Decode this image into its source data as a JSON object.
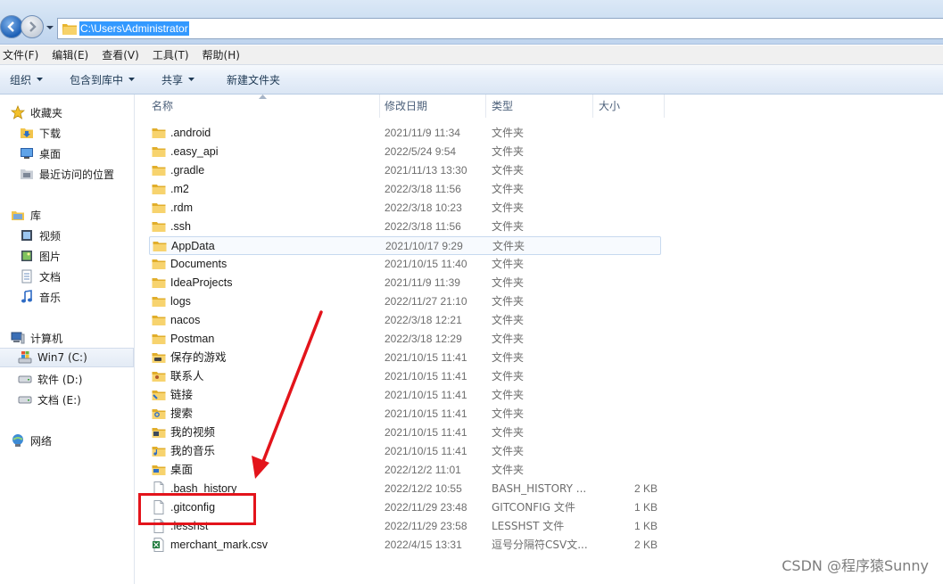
{
  "address": {
    "path": "C:\\Users\\Administrator"
  },
  "menu": [
    "文件(F)",
    "编辑(E)",
    "查看(V)",
    "工具(T)",
    "帮助(H)"
  ],
  "toolbar": {
    "organize": "组织",
    "include_library": "包含到库中",
    "share": "共享",
    "new_folder": "新建文件夹"
  },
  "nav": {
    "favorites": "收藏夹",
    "downloads": "下载",
    "desktop": "桌面",
    "recent": "最近访问的位置",
    "libraries": "库",
    "videos": "视频",
    "pictures": "图片",
    "documents": "文档",
    "music": "音乐",
    "computer": "计算机",
    "drive_c": "Win7 (C:)",
    "drive_d": "软件 (D:)",
    "drive_e": "文档 (E:)",
    "network": "网络"
  },
  "columns": {
    "name": "名称",
    "modified": "修改日期",
    "type": "类型",
    "size": "大小"
  },
  "files": [
    {
      "name": ".android",
      "date": "2021/11/9 11:34",
      "type": "文件夹",
      "size": "",
      "icon": "folder-icon"
    },
    {
      "name": ".easy_api",
      "date": "2022/5/24 9:54",
      "type": "文件夹",
      "size": "",
      "icon": "folder-icon"
    },
    {
      "name": ".gradle",
      "date": "2021/11/13 13:30",
      "type": "文件夹",
      "size": "",
      "icon": "folder-icon"
    },
    {
      "name": ".m2",
      "date": "2022/3/18 11:56",
      "type": "文件夹",
      "size": "",
      "icon": "folder-icon"
    },
    {
      "name": ".rdm",
      "date": "2022/3/18 10:23",
      "type": "文件夹",
      "size": "",
      "icon": "folder-icon"
    },
    {
      "name": ".ssh",
      "date": "2022/3/18 11:56",
      "type": "文件夹",
      "size": "",
      "icon": "folder-icon"
    },
    {
      "name": "AppData",
      "date": "2021/10/17 9:29",
      "type": "文件夹",
      "size": "",
      "icon": "folder-icon"
    },
    {
      "name": "Documents",
      "date": "2021/10/15 11:40",
      "type": "文件夹",
      "size": "",
      "icon": "folder-icon"
    },
    {
      "name": "IdeaProjects",
      "date": "2021/11/9 11:39",
      "type": "文件夹",
      "size": "",
      "icon": "folder-icon"
    },
    {
      "name": "logs",
      "date": "2022/11/27 21:10",
      "type": "文件夹",
      "size": "",
      "icon": "folder-icon"
    },
    {
      "name": "nacos",
      "date": "2022/3/18 12:21",
      "type": "文件夹",
      "size": "",
      "icon": "folder-icon"
    },
    {
      "name": "Postman",
      "date": "2022/3/18 12:29",
      "type": "文件夹",
      "size": "",
      "icon": "folder-icon"
    },
    {
      "name": "保存的游戏",
      "date": "2021/10/15 11:41",
      "type": "文件夹",
      "size": "",
      "icon": "saved-games-folder-icon"
    },
    {
      "name": "联系人",
      "date": "2021/10/15 11:41",
      "type": "文件夹",
      "size": "",
      "icon": "contacts-folder-icon"
    },
    {
      "name": "链接",
      "date": "2021/10/15 11:41",
      "type": "文件夹",
      "size": "",
      "icon": "links-folder-icon"
    },
    {
      "name": "搜索",
      "date": "2021/10/15 11:41",
      "type": "文件夹",
      "size": "",
      "icon": "searches-folder-icon"
    },
    {
      "name": "我的视频",
      "date": "2021/10/15 11:41",
      "type": "文件夹",
      "size": "",
      "icon": "videos-folder-icon"
    },
    {
      "name": "我的音乐",
      "date": "2021/10/15 11:41",
      "type": "文件夹",
      "size": "",
      "icon": "music-folder-icon"
    },
    {
      "name": "桌面",
      "date": "2022/12/2 11:01",
      "type": "文件夹",
      "size": "",
      "icon": "desktop-folder-icon"
    },
    {
      "name": ".bash_history",
      "date": "2022/12/2 10:55",
      "type": "BASH_HISTORY ...",
      "size": "2 KB",
      "icon": "file-icon"
    },
    {
      "name": ".gitconfig",
      "date": "2022/11/29 23:48",
      "type": "GITCONFIG 文件",
      "size": "1 KB",
      "icon": "file-icon"
    },
    {
      "name": ".lesshst",
      "date": "2022/11/29 23:58",
      "type": "LESSHST 文件",
      "size": "1 KB",
      "icon": "file-icon"
    },
    {
      "name": "merchant_mark.csv",
      "date": "2022/4/15 13:31",
      "type": "逗号分隔符CSV文...",
      "size": "2 KB",
      "icon": "csv-file-icon"
    }
  ],
  "watermark": "CSDN @程序猿Sunny",
  "colors": {
    "accent": "#3399ff",
    "annotation_red": "#e3141b",
    "folder_yellow": "#f2c44b"
  }
}
